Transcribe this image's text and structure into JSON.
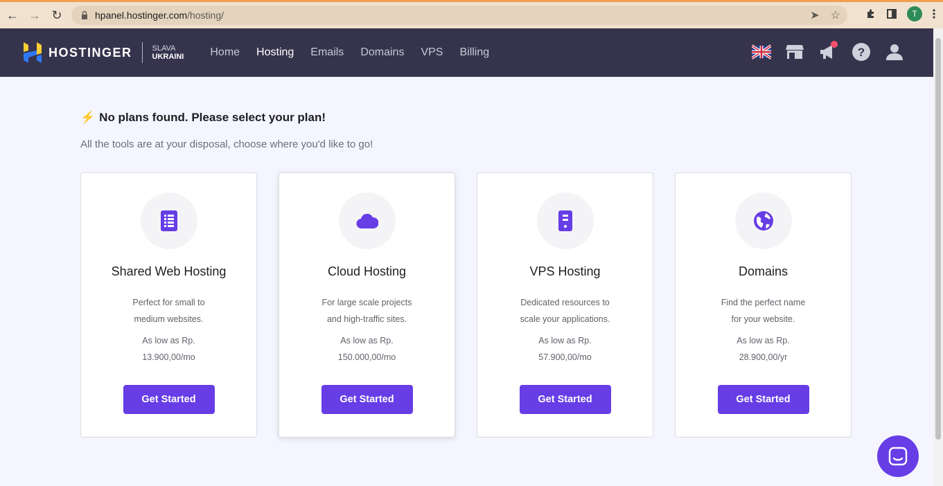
{
  "browser": {
    "url_host": "hpanel.hostinger.com",
    "url_path": "/hosting/",
    "profile_initial": "T"
  },
  "header": {
    "logo_text": "HOSTINGER",
    "slava_line1": "SLAVA",
    "slava_line2": "UKRAINI",
    "nav": [
      "Home",
      "Hosting",
      "Emails",
      "Domains",
      "VPS",
      "Billing"
    ],
    "active_nav": "Hosting",
    "colors": {
      "bg": "#36344d",
      "accent": "#673de6",
      "notif": "#ff4f6e"
    }
  },
  "main": {
    "headline": "No plans found. Please select your plan!",
    "subline": "All the tools are at your disposal, choose where you'd like to go!",
    "cards": [
      {
        "icon": "list-icon",
        "title": "Shared Web Hosting",
        "desc1": "Perfect for small to",
        "desc2": "medium websites.",
        "price1": "As low as Rp.",
        "price2": "13.900,00/mo",
        "button": "Get Started"
      },
      {
        "icon": "cloud-icon",
        "title": "Cloud Hosting",
        "desc1": "For large scale projects",
        "desc2": "and high-traffic sites.",
        "price1": "As low as Rp.",
        "price2": "150.000,00/mo",
        "button": "Get Started"
      },
      {
        "icon": "server-icon",
        "title": "VPS Hosting",
        "desc1": "Dedicated resources to",
        "desc2": "scale your applications.",
        "price1": "As low as Rp.",
        "price2": "57.900,00/mo",
        "button": "Get Started"
      },
      {
        "icon": "globe-icon",
        "title": "Domains",
        "desc1": "Find the perfect name",
        "desc2": "for your website.",
        "price1": "As low as Rp.",
        "price2": "28.900,00/yr",
        "button": "Get Started"
      }
    ]
  }
}
